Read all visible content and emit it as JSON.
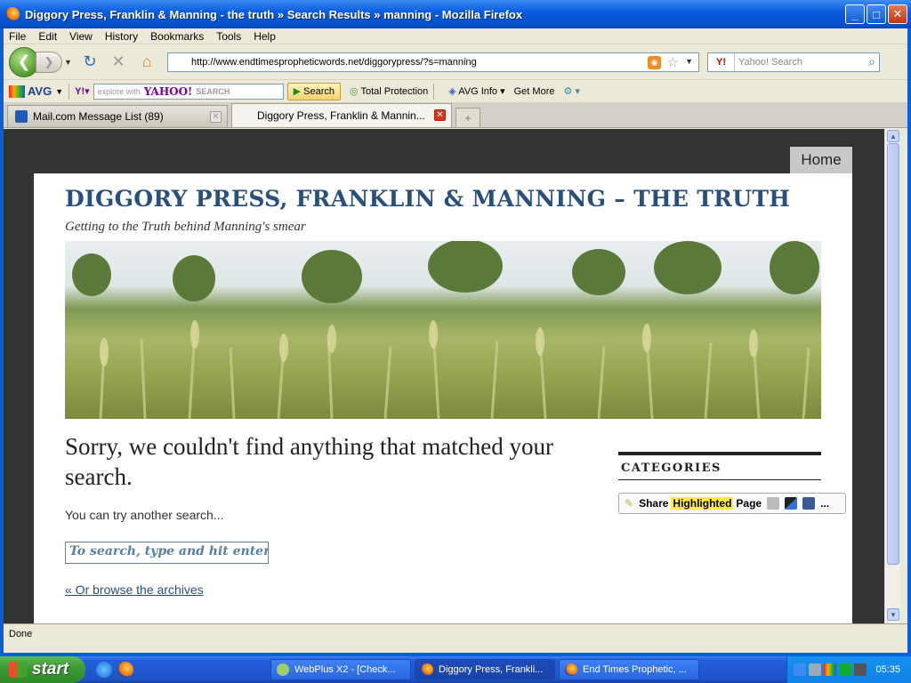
{
  "window": {
    "title": "Diggory Press, Franklin & Manning - the truth » Search Results » manning - Mozilla Firefox",
    "buttons": {
      "minimize": "_",
      "maximize": "□",
      "close": "✕"
    }
  },
  "menu": [
    "File",
    "Edit",
    "View",
    "History",
    "Bookmarks",
    "Tools",
    "Help"
  ],
  "nav": {
    "url": "http://www.endtimespropheticwords.net/diggorypress/?s=manning",
    "search_placeholder": "Yahoo! Search",
    "yahoo_badge": "Y!"
  },
  "toolbar": {
    "avg_label": "AVG",
    "yahoo_prefix": "explore with",
    "yahoo_brand": "YAHOO!",
    "yahoo_search_word": "SEARCH",
    "search_button": "Search",
    "total_protection": "Total Protection",
    "avg_info": "AVG Info",
    "get_more": "Get More"
  },
  "tabs": [
    {
      "label": "Mail.com Message List (89)",
      "active": false
    },
    {
      "label": "Diggory Press, Franklin & Mannin...",
      "active": true
    }
  ],
  "page": {
    "home_label": "Home",
    "site_title": "DIGGORY PRESS, FRANKLIN & MANNING – THE TRUTH",
    "tagline": "Getting to the Truth behind Manning's smear",
    "sorry": "Sorry, we couldn't find anything that matched your search.",
    "try_again": "You can try another search...",
    "search_placeholder": "To search, type and hit enter...",
    "browse_archives": "« Or browse the archives",
    "categories_heading": "CATEGORIES",
    "share": {
      "pre": "Share",
      "highlight": "Highlighted",
      "post": "Page",
      "more": "..."
    }
  },
  "status": "Done",
  "taskbar": {
    "start": "start",
    "tasks": [
      {
        "label": "WebPlus X2 - [Check...",
        "active": false
      },
      {
        "label": "Diggory Press, Frankli...",
        "active": true
      },
      {
        "label": "End Times Prophetic, ...",
        "active": false
      }
    ],
    "clock": "05:35"
  },
  "colors": {
    "title_blue": "#2a4f7a",
    "page_bg": "#333333",
    "xp_blue": "#0a5ede"
  }
}
